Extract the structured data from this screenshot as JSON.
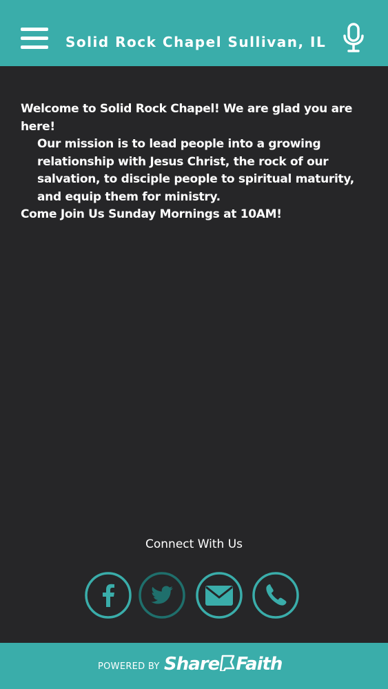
{
  "header": {
    "title": "Solid Rock Chapel Sullivan, IL",
    "menu_icon": "hamburger-menu-icon",
    "mic_icon": "microphone-icon",
    "background": "#3aadaa"
  },
  "content": {
    "welcome": "Welcome to Solid Rock Chapel! We are glad you are here!",
    "mission": "Our mission is to lead people into a growing relationship with Jesus Christ, the rock of our salvation, to disciple people to spiritual maturity, and equip them for ministry.",
    "service_time": "Come Join Us Sunday Mornings at 10AM!"
  },
  "connect": {
    "heading": "Connect With Us",
    "links": [
      {
        "icon": "facebook-icon"
      },
      {
        "icon": "twitter-icon"
      },
      {
        "icon": "email-icon"
      },
      {
        "icon": "phone-icon"
      }
    ],
    "accent": "#3aadaa",
    "twitter_accent": "#1f6f6c"
  },
  "footer": {
    "powered_by": "POWERED BY",
    "brand_part1": "Share",
    "brand_part2": "Faith",
    "background": "#3aadaa"
  }
}
